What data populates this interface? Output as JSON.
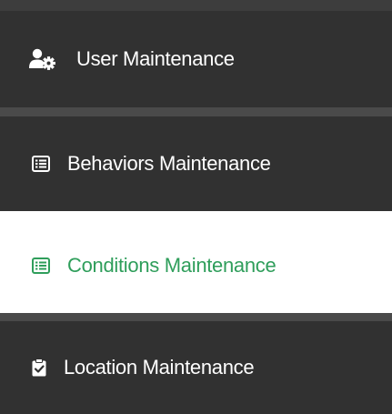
{
  "menu": {
    "items": [
      {
        "label": "User Maintenance",
        "icon": "user-gear-icon",
        "active": false
      },
      {
        "label": "Behaviors Maintenance",
        "icon": "list-alt-icon",
        "active": false
      },
      {
        "label": "Conditions Maintenance",
        "icon": "list-alt-icon",
        "active": true
      },
      {
        "label": "Location Maintenance",
        "icon": "clipboard-check-icon",
        "active": false
      }
    ]
  },
  "colors": {
    "item_background": "#313131",
    "item_text": "#ffffff",
    "active_background": "#ffffff",
    "active_text": "#2f9e5b",
    "divider": "#4a4a4a"
  }
}
